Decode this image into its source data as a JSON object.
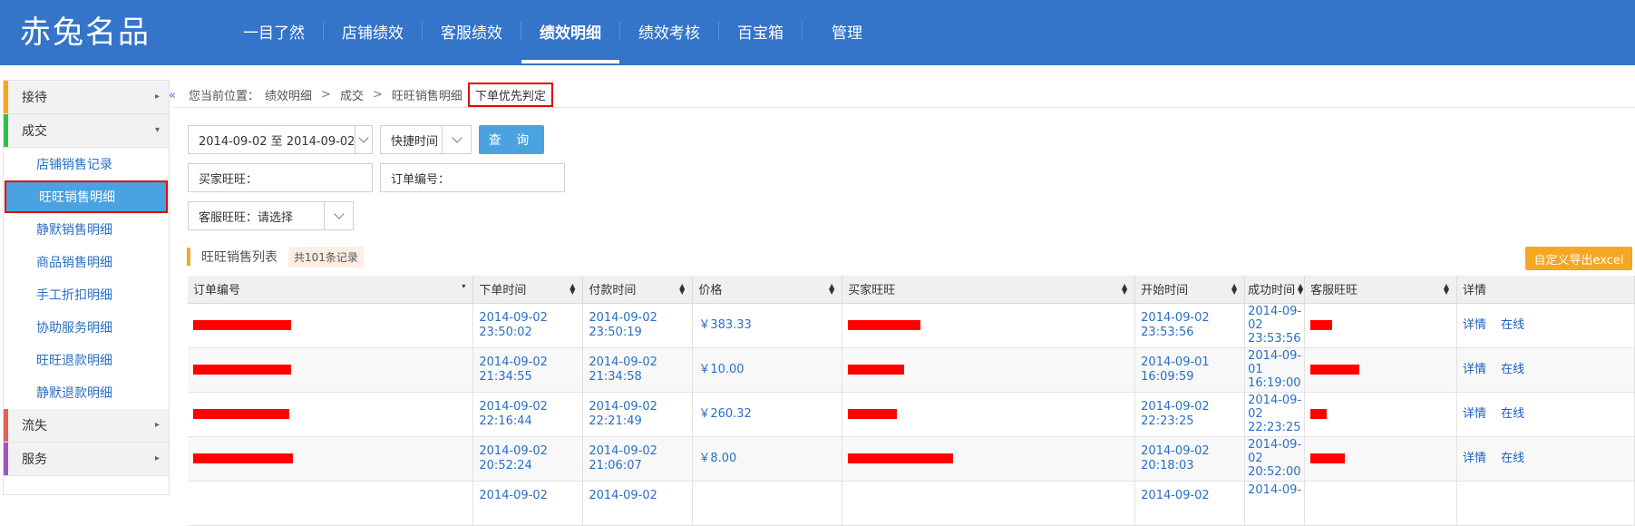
{
  "app": {
    "logo": "赤兔名品"
  },
  "nav": [
    {
      "label": "一目了然",
      "active": false
    },
    {
      "label": "店铺绩效",
      "active": false
    },
    {
      "label": "客服绩效",
      "active": false
    },
    {
      "label": "绩效明细",
      "active": true
    },
    {
      "label": "绩效考核",
      "active": false
    },
    {
      "label": "百宝箱",
      "active": false
    },
    {
      "label": "管理",
      "active": false
    }
  ],
  "sidebar": {
    "collapse_icon": "«",
    "groups": [
      {
        "label": "接待",
        "color": "#f5a623",
        "arrow": "▸"
      },
      {
        "label": "成交",
        "color": "#2fbf4a",
        "arrow": "▾"
      },
      {
        "label": "流失",
        "color": "#e0635a",
        "arrow": "▸"
      },
      {
        "label": "服务",
        "color": "#9b59b6",
        "arrow": "▸"
      }
    ],
    "sub_items": [
      "店铺销售记录",
      "旺旺销售明细",
      "静默销售明细",
      "商品销售明细",
      "手工折扣明细",
      "协助服务明细",
      "旺旺退款明细",
      "静默退款明细"
    ],
    "active_sub": "旺旺销售明细"
  },
  "breadcrumb": {
    "prefix": "您当前位置：",
    "items": [
      "绩效明细",
      "成交",
      "旺旺销售明细"
    ],
    "separator": ">",
    "current": "下单优先判定"
  },
  "filters": {
    "date_range": "2014-09-02 至 2014-09-02",
    "quick_time": "快捷时间",
    "query_button": "查 询",
    "buyer_label": "买家旺旺：",
    "order_label": "订单编号：",
    "service_select": "客服旺旺：请选择"
  },
  "list": {
    "title": "旺旺销售列表",
    "count": "共101条记录",
    "export_button": "自定义导出excel"
  },
  "table": {
    "columns": [
      "订单编号",
      "下单时间",
      "付款时间",
      "价格",
      "买家旺旺",
      "开始时间",
      "成功时间",
      "客服旺旺",
      "详情"
    ],
    "detail_link": "详情",
    "online_link": "在线",
    "rows": [
      {
        "order_time": [
          "2014-09-02",
          "23:50:02"
        ],
        "pay_time": [
          "2014-09-02",
          "23:50:19"
        ],
        "price": "￥383.33",
        "start_time": [
          "2014-09-02",
          "23:53:56"
        ],
        "success_time": [
          "2014-09-",
          "02",
          "23:53:56"
        ]
      },
      {
        "order_time": [
          "2014-09-02",
          "21:34:55"
        ],
        "pay_time": [
          "2014-09-02",
          "21:34:58"
        ],
        "price": "￥10.00",
        "start_time": [
          "2014-09-01",
          "16:09:59"
        ],
        "success_time": [
          "2014-09-",
          "01",
          "16:19:00"
        ]
      },
      {
        "order_time": [
          "2014-09-02",
          "22:16:44"
        ],
        "pay_time": [
          "2014-09-02",
          "22:21:49"
        ],
        "price": "￥260.32",
        "start_time": [
          "2014-09-02",
          "22:23:25"
        ],
        "success_time": [
          "2014-09-",
          "02",
          "22:23:25"
        ]
      },
      {
        "order_time": [
          "2014-09-02",
          "20:52:24"
        ],
        "pay_time": [
          "2014-09-02",
          "21:06:07"
        ],
        "price": "￥8.00",
        "start_time": [
          "2014-09-02",
          "20:18:03"
        ],
        "success_time": [
          "2014-09-",
          "02",
          "20:52:00"
        ]
      },
      {
        "order_time": [
          "2014-09-02",
          ""
        ],
        "pay_time": [
          "2014-09-02",
          ""
        ],
        "price": "",
        "start_time": [
          "2014-09-02",
          ""
        ],
        "success_time": [
          "2014-09-",
          "",
          ""
        ]
      }
    ]
  },
  "icons": {
    "sort": "sort-icon",
    "dropdown": "chevron-down-icon",
    "collapse": "collapse-left-icon"
  }
}
